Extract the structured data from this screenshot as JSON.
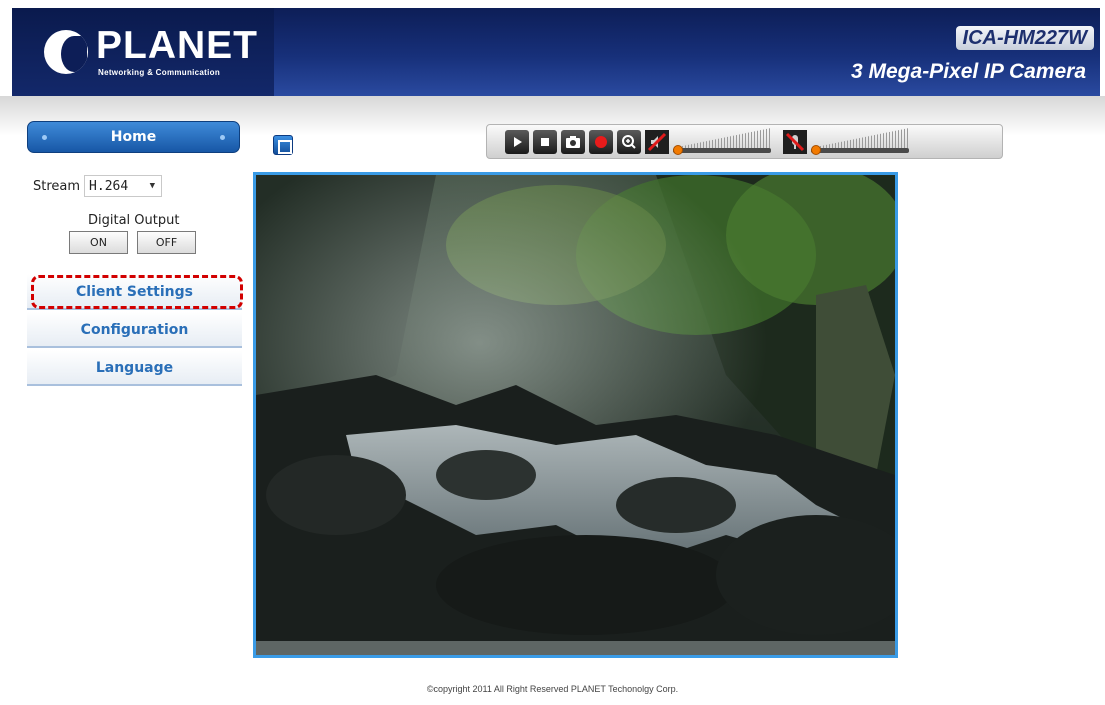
{
  "header": {
    "logo_text": "PLANET",
    "logo_sub": "Networking & Communication",
    "model": "ICA-HM227W",
    "product": "3 Mega-Pixel IP Camera"
  },
  "sidebar": {
    "home_label": "Home",
    "stream_label": "Stream",
    "stream_value": "H.264",
    "digital_output_label": "Digital Output",
    "on_label": "ON",
    "off_label": "OFF",
    "menu": [
      {
        "label": "Client Settings",
        "highlighted": true
      },
      {
        "label": "Configuration"
      },
      {
        "label": "Language"
      }
    ]
  },
  "toolbar": {
    "buttons": [
      "play-icon",
      "stop-icon",
      "snapshot-icon",
      "record-icon",
      "zoom-in-icon",
      "speaker-muted-icon",
      "microphone-muted-icon"
    ],
    "speaker_volume": 0.0,
    "microphone_volume": 0.0
  },
  "colors": {
    "accent": "#2a6fb8",
    "header": "#17307a",
    "highlight_border": "#d20000",
    "video_border": "#3a9be6"
  },
  "footer": {
    "copyright": "©copyright 2011 All Right Reserved PLANET Techonolgy Corp."
  }
}
